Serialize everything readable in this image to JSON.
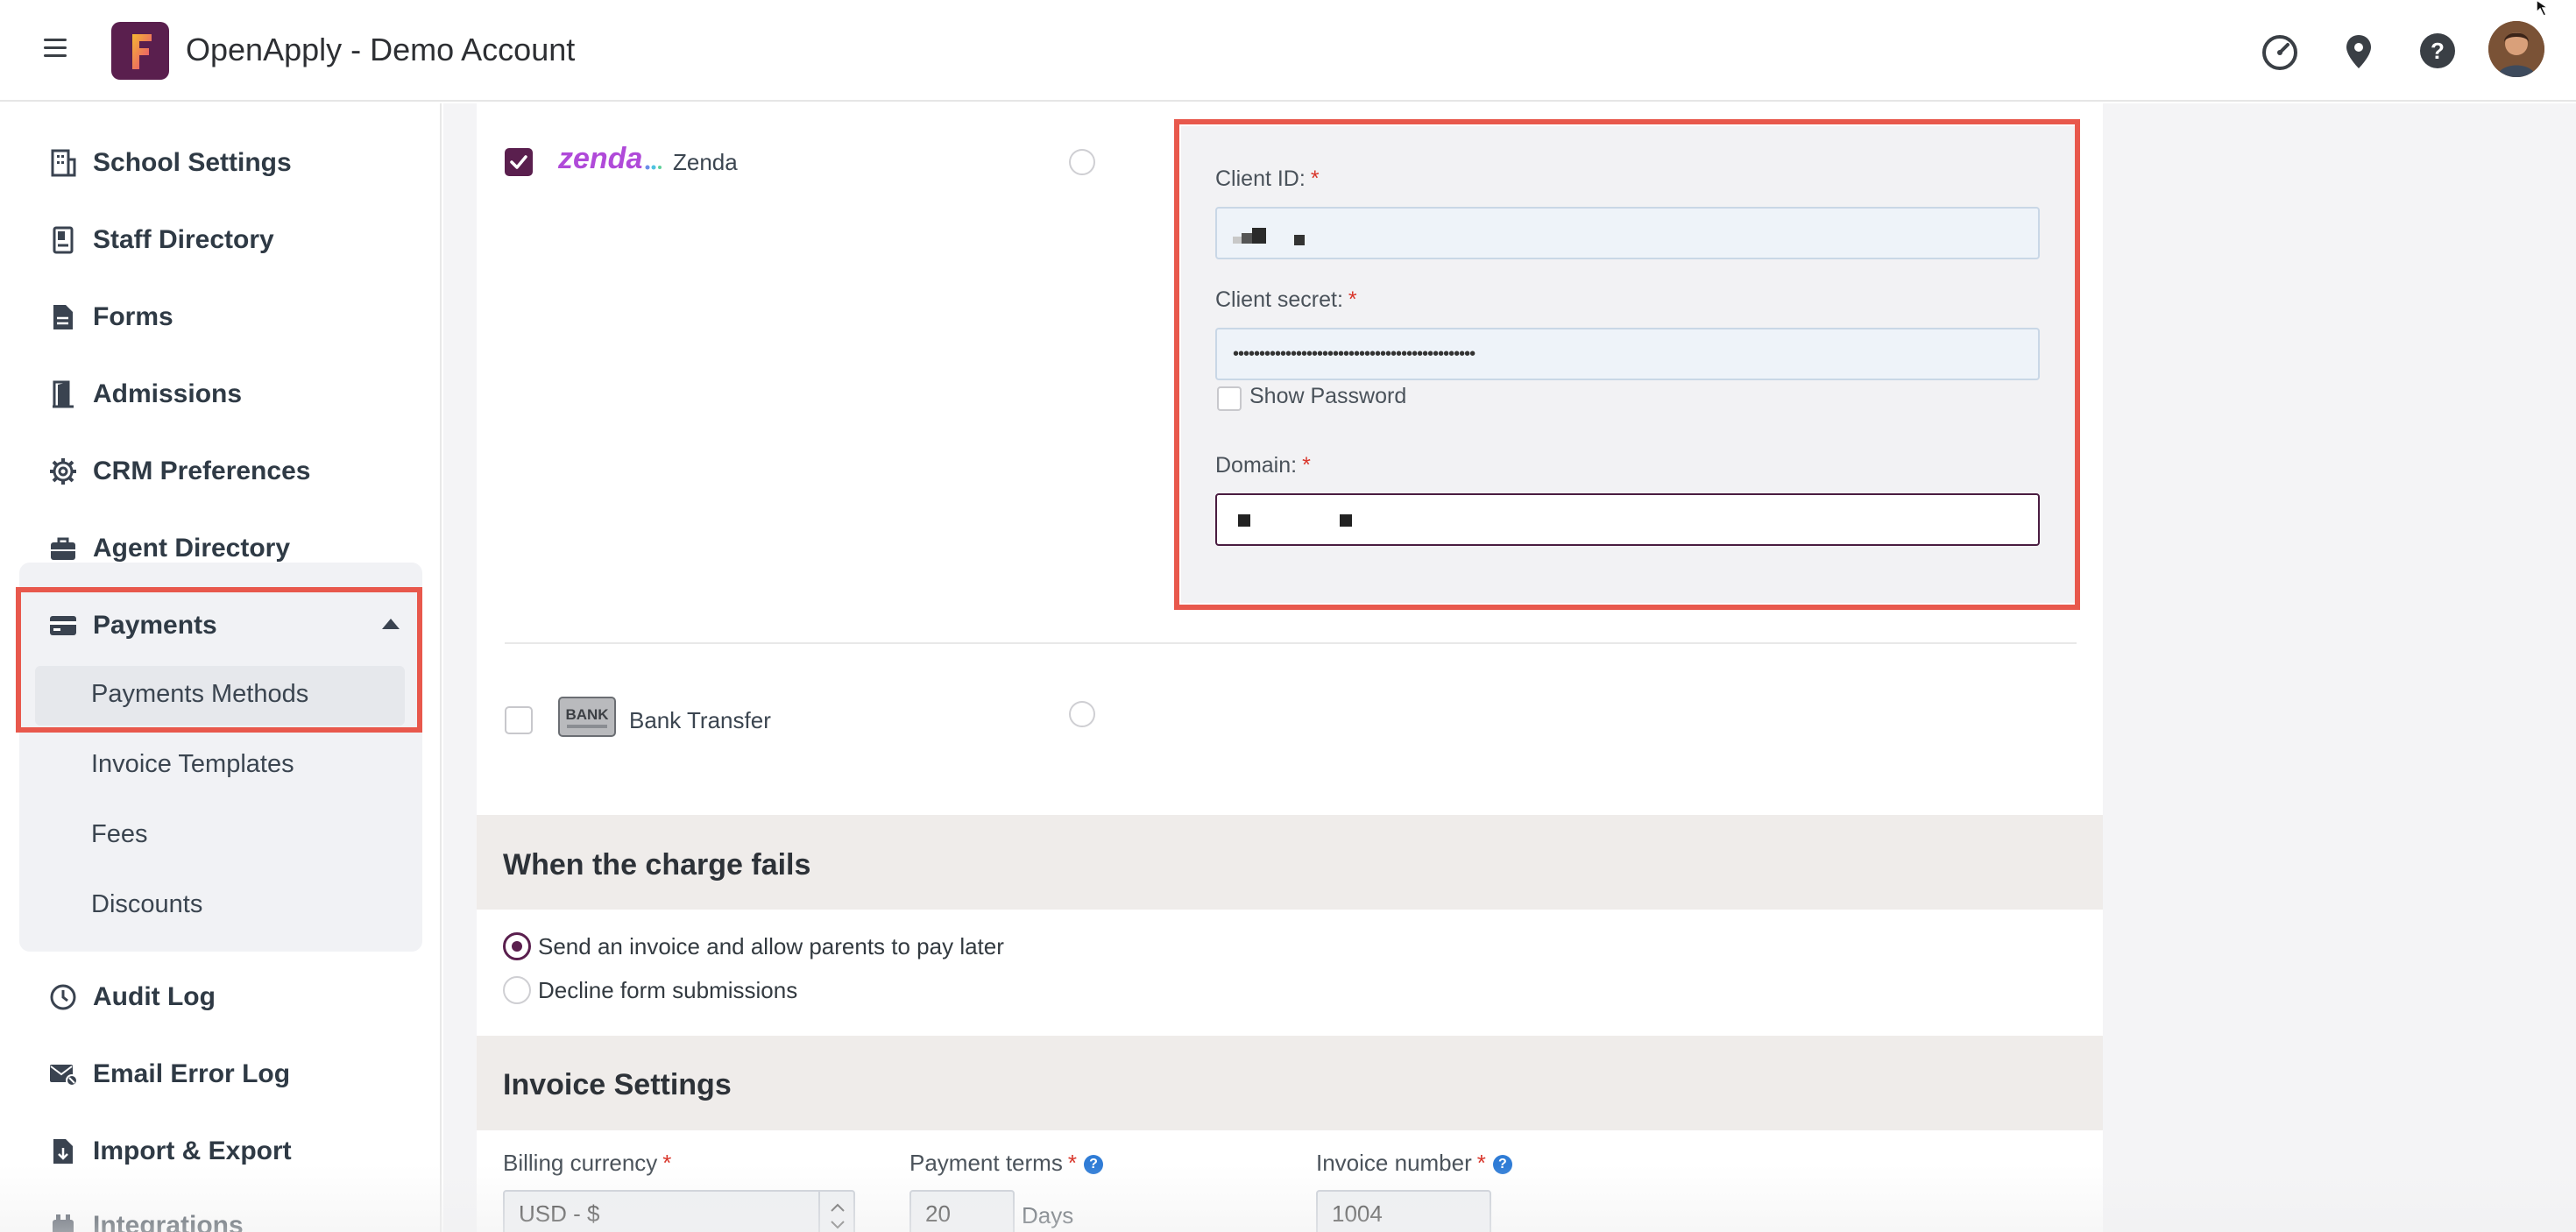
{
  "header": {
    "app_title": "OpenApply - Demo Account",
    "logo_letter": "F",
    "icons": [
      "dashboard-icon",
      "location-icon",
      "help-icon",
      "avatar"
    ]
  },
  "sidebar": {
    "items": [
      {
        "label": "School Settings",
        "icon": "building-icon"
      },
      {
        "label": "Staff Directory",
        "icon": "book-icon"
      },
      {
        "label": "Forms",
        "icon": "document-icon"
      },
      {
        "label": "Admissions",
        "icon": "door-icon"
      },
      {
        "label": "CRM Preferences",
        "icon": "gear-icon"
      },
      {
        "label": "Agent Directory",
        "icon": "briefcase-icon"
      },
      {
        "label": "Payments",
        "icon": "credit-card-icon",
        "expanded": true
      },
      {
        "label": "Audit Log",
        "icon": "clock-icon"
      },
      {
        "label": "Email Error Log",
        "icon": "email-error-icon"
      },
      {
        "label": "Import & Export",
        "icon": "file-import-icon"
      },
      {
        "label": "Integrations",
        "icon": "integrations-icon"
      }
    ],
    "payments_sub": [
      {
        "label": "Payments Methods",
        "active": true
      },
      {
        "label": "Invoice Templates"
      },
      {
        "label": "Fees"
      },
      {
        "label": "Discounts"
      }
    ]
  },
  "providers": [
    {
      "name": "Zenda",
      "logo_text": "zenda",
      "checked": true
    },
    {
      "name": "Bank Transfer",
      "logo_text": "BANK",
      "checked": false
    }
  ],
  "credentials": {
    "client_id_label": "Client ID:",
    "client_secret_label": "Client secret:",
    "client_secret_value": "••••••••••••••••••••••••••••••••••••••••••••••",
    "show_password_label": "Show Password",
    "domain_label": "Domain:",
    "required_mark": "*"
  },
  "charge_fails": {
    "title": "When the charge fails",
    "options": [
      {
        "label": "Send an invoice and allow parents to pay later",
        "selected": true
      },
      {
        "label": "Decline form submissions",
        "selected": false
      }
    ]
  },
  "invoice_settings": {
    "title": "Invoice Settings",
    "billing_currency_label": "Billing currency",
    "billing_currency_value": "USD - $",
    "payment_terms_label": "Payment terms",
    "payment_terms_value": "20",
    "payment_terms_unit": "Days",
    "invoice_number_label": "Invoice number",
    "invoice_number_value": "1004",
    "help_glyph": "?"
  },
  "colors": {
    "brand": "#5a1f4e",
    "highlight": "#e8584c",
    "required": "#d9362b",
    "help": "#2f7cd6"
  }
}
